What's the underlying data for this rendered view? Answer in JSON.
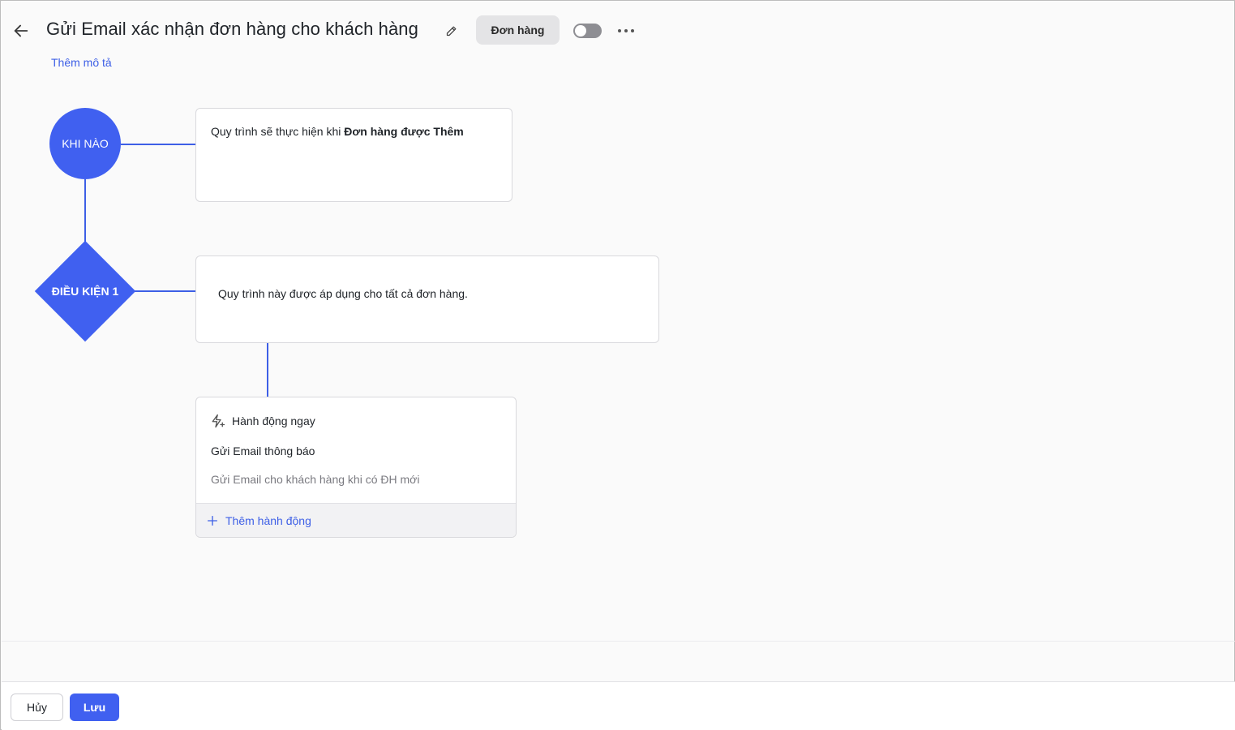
{
  "header": {
    "title": "Gửi Email xác nhận đơn hàng cho khách hàng",
    "tag_label": "Đơn hàng",
    "add_description": "Thêm mô tả",
    "icons": {
      "back": "arrow-left-icon",
      "edit": "pencil-icon",
      "more": "more-horizontal-icon"
    },
    "toggle_on": false
  },
  "flow": {
    "trigger_node_label": "KHI NÀO",
    "trigger_text_prefix": "Quy trình sẽ thực hiện khi ",
    "trigger_text_bold": "Đơn hàng được Thêm",
    "condition_node_label": "ĐIỀU KIỆN 1",
    "condition_text": "Quy trình này được áp dụng cho tất cả đơn hàng.",
    "action_card": {
      "header": "Hành động ngay",
      "title": "Gửi Email thông báo",
      "description": "Gửi Email cho khách hàng khi có ĐH mới",
      "add_action": "Thêm hành động",
      "icons": {
        "header": "lightning-plus-icon",
        "add": "plus-icon"
      }
    }
  },
  "footer": {
    "cancel_label": "Hủy",
    "save_label": "Lưu"
  },
  "colors": {
    "accent": "#4060f0",
    "link": "#3d5fe6",
    "background": "#fafafa"
  }
}
